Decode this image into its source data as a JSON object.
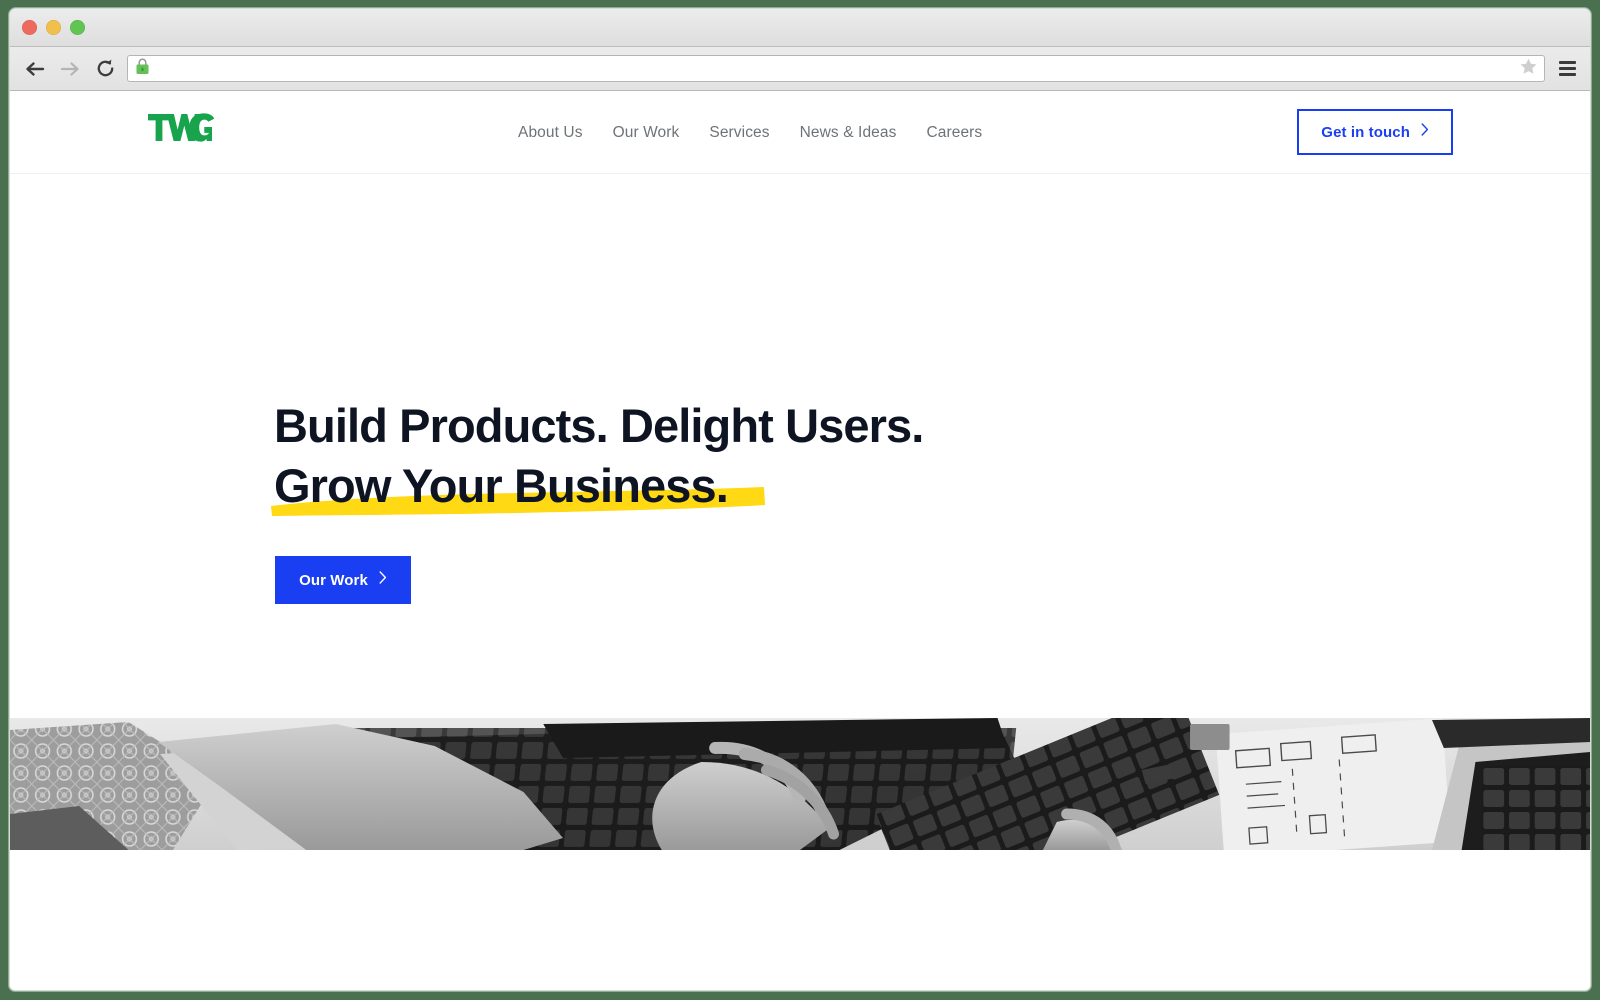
{
  "window": {
    "frame_color": "#4a7050",
    "traffic_lights": [
      {
        "name": "close",
        "color": "#ee6a5f"
      },
      {
        "name": "minimize",
        "color": "#f0bf4c"
      },
      {
        "name": "maximize",
        "color": "#61c554"
      }
    ]
  },
  "browser": {
    "back_icon": "back-arrow-icon",
    "forward_icon": "forward-arrow-icon",
    "reload_icon": "reload-icon",
    "lock_icon": "secure-lock-icon",
    "lock_color": "#63c157",
    "url_value": "",
    "url_placeholder": "",
    "bookmark_icon": "star-icon",
    "menu_icon": "hamburger-menu-icon"
  },
  "site": {
    "logo_text": "TWG",
    "logo_color": "#17a44c",
    "nav": [
      {
        "label": "About Us"
      },
      {
        "label": "Our Work"
      },
      {
        "label": "Services"
      },
      {
        "label": "News & Ideas"
      },
      {
        "label": "Careers"
      }
    ],
    "header_cta": {
      "label": "Get in touch",
      "chevron_icon": "chevron-right-icon",
      "color": "#1a3ff2"
    }
  },
  "hero": {
    "headline_line_1": "Build Products. Delight Users.",
    "headline_line_2": "Grow Your Business.",
    "headline_color": "#0e1422",
    "highlight_color": "#ffd913",
    "cta": {
      "label": "Our Work",
      "chevron_icon": "chevron-right-icon",
      "background": "#1a3ff2",
      "text_color": "#ffffff"
    }
  },
  "photo": {
    "description": "black-and-white photo of hands typing on laptops at a desk with a sketch notebook",
    "style": "grayscale"
  }
}
